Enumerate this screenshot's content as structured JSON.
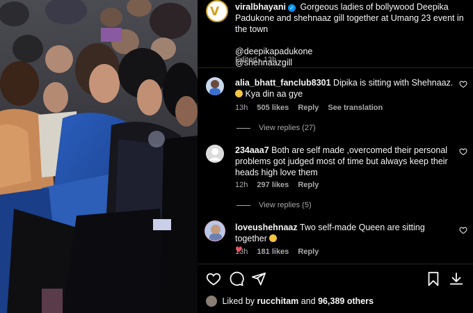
{
  "post": {
    "author": "viralbhayani",
    "caption": "Gorgeous ladies of bollywood Deepika Padukone and shehnaaz gill together at Umang 23 event in the town",
    "mentions": [
      "@deepikapadukone",
      "@shehnaazgill"
    ],
    "edited_label": "Edited",
    "time": "13h",
    "verified_glyph": "✓"
  },
  "comments": [
    {
      "username": "alia_bhatt_fanclub8301",
      "text": "Dipika is sitting with Shehnaaz.",
      "text_after_emoji": "Kya din aa gye",
      "time": "13h",
      "likes": "505 likes",
      "reply": "Reply",
      "translate": "See translation",
      "view_replies": "View replies (27)"
    },
    {
      "username": "234aaa7",
      "text": "Both are self made ,overcomed their personal problems got judged most of time but always keep their heads high love them",
      "time": "12h",
      "likes": "297 likes",
      "reply": "Reply",
      "view_replies": "View replies (5)"
    },
    {
      "username": "loveushehnaaz",
      "text": "Two self-made Queen are sitting together",
      "time": "13h",
      "likes": "181 likes",
      "reply": "Reply"
    }
  ],
  "actions": {
    "like_icon": "heart-icon",
    "comment_icon": "comment-icon",
    "share_icon": "share-icon",
    "save_icon": "bookmark-icon",
    "download_icon": "download-icon"
  },
  "likes_summary": {
    "prefix": "Liked by",
    "user": "rucchitam",
    "joiner": "and",
    "others": "96,389 others"
  },
  "colors": {
    "background": "#000000",
    "text": "#f5f5f5",
    "secondary": "#a8a8a8",
    "verified": "#0095f6"
  }
}
